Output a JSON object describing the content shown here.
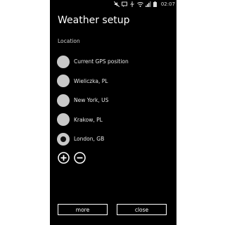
{
  "status_bar": {
    "time": "02:07",
    "icons": [
      "no-sound-icon",
      "message-icon",
      "usb-icon",
      "wifi-icon",
      "signal-icon",
      "battery-icon"
    ]
  },
  "page": {
    "title": "Weather setup"
  },
  "location_section": {
    "label": "Location",
    "items": [
      {
        "label": "Current GPS position",
        "selected": false
      },
      {
        "label": "Wieliczka, PL",
        "selected": false
      },
      {
        "label": "New York, US",
        "selected": false
      },
      {
        "label": "Krakow, PL",
        "selected": false
      },
      {
        "label": "London, GB",
        "selected": true
      }
    ]
  },
  "actions": {
    "add_icon": "add-circle-icon",
    "remove_icon": "remove-circle-icon"
  },
  "buttons": {
    "more_label": "more",
    "close_label": "close"
  },
  "colors": {
    "background": "#000000",
    "radio_fill": "#c8c8c8",
    "text": "#ffffff"
  }
}
